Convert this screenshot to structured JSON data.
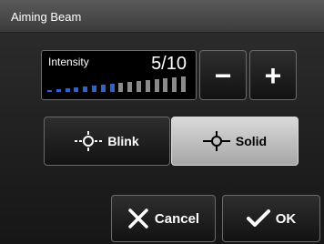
{
  "window": {
    "title": "Aiming Beam"
  },
  "intensity": {
    "label": "Intensity",
    "display_value": "5/10",
    "level": 5,
    "max": 10,
    "bar_count": 16,
    "decrease_label": "−",
    "increase_label": "+"
  },
  "mode": {
    "options": [
      {
        "label": "Blink",
        "icon": "blink-crosshair-icon",
        "selected": false
      },
      {
        "label": "Solid",
        "icon": "solid-crosshair-icon",
        "selected": true
      }
    ]
  },
  "actions": {
    "cancel_label": "Cancel",
    "cancel_icon": "close-icon",
    "ok_label": "OK",
    "ok_icon": "checkmark-icon"
  },
  "colors": {
    "bar_active": "#2f63c8",
    "bar_inactive": "#8b8b8b",
    "selected_button": "#bdbdbd"
  }
}
